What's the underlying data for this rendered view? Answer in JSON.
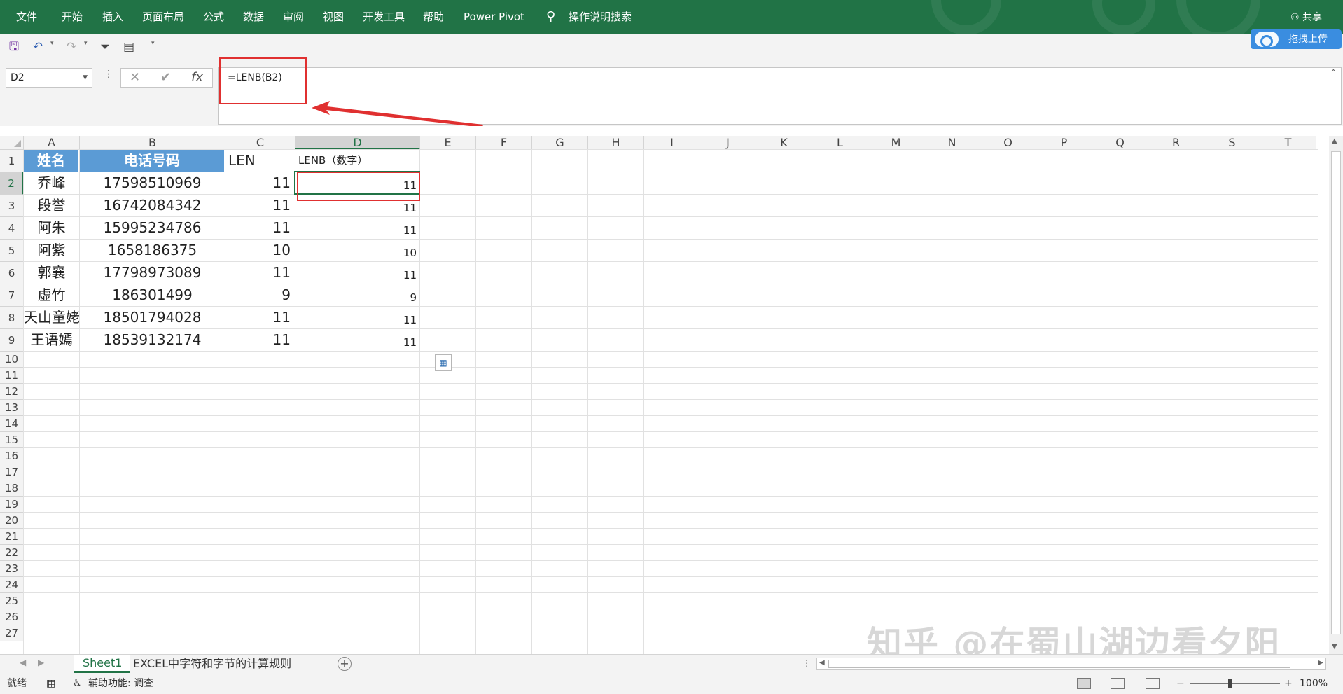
{
  "ribbon": {
    "tabs": [
      "文件",
      "开始",
      "插入",
      "页面布局",
      "公式",
      "数据",
      "审阅",
      "视图",
      "开发工具",
      "帮助",
      "Power Pivot"
    ],
    "tell_me": "操作说明搜索",
    "share": "共享",
    "accent": "#217346"
  },
  "upload_button": {
    "label": "拖拽上传",
    "color": "#3a8de0"
  },
  "formula_bar": {
    "name_box": "D2",
    "cancel_icon": "✕",
    "enter_icon": "✔",
    "fx_icon": "fx",
    "formula": "=LENB(B2)"
  },
  "sheet": {
    "columns": [
      "A",
      "B",
      "C",
      "D",
      "E",
      "F",
      "G",
      "H",
      "I",
      "J",
      "K",
      "L",
      "M",
      "N",
      "O",
      "P",
      "Q",
      "R",
      "S",
      "T"
    ],
    "row_numbers": [
      "1",
      "2",
      "3",
      "4",
      "5",
      "6",
      "7",
      "8",
      "9",
      "10",
      "11",
      "12",
      "13",
      "14",
      "15",
      "16",
      "17",
      "18",
      "19",
      "20",
      "21",
      "22",
      "23",
      "24",
      "25",
      "26",
      "27"
    ],
    "header_row": {
      "A": "姓名",
      "B": "电话号码",
      "C": "LEN",
      "D": "LENB（数字）"
    },
    "rows": [
      {
        "A": "乔峰",
        "B": "17598510969",
        "C": "11",
        "D": "11"
      },
      {
        "A": "段誉",
        "B": "16742084342",
        "C": "11",
        "D": "11"
      },
      {
        "A": "阿朱",
        "B": "15995234786",
        "C": "11",
        "D": "11"
      },
      {
        "A": "阿紫",
        "B": "1658186375",
        "C": "10",
        "D": "10"
      },
      {
        "A": "郭襄",
        "B": "17798973089",
        "C": "11",
        "D": "11"
      },
      {
        "A": "虚竹",
        "B": "186301499",
        "C": "9",
        "D": "9"
      },
      {
        "A": "天山童姥",
        "B": "18501794028",
        "C": "11",
        "D": "11"
      },
      {
        "A": "王语嫣",
        "B": "18539132174",
        "C": "11",
        "D": "11"
      }
    ],
    "selected_cell": "D2",
    "header_fill": "#5b9bd5",
    "highlight_color": "#e03030"
  },
  "sheet_tabs": {
    "active": "Sheet1",
    "other": "EXCEL中字符和字节的计算规则"
  },
  "status": {
    "ready": "就绪",
    "accessibility": "辅助功能: 调查",
    "zoom": "100%"
  },
  "watermark": "知乎 @在蜀山湖边看夕阳"
}
